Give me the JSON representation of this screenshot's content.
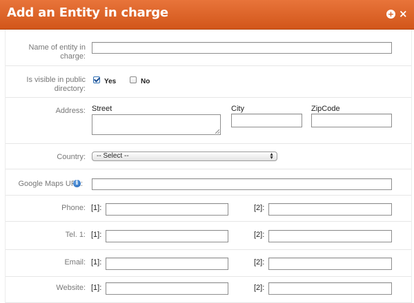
{
  "header": {
    "title": "Add an Entity in charge"
  },
  "fields": {
    "name_label": "Name of entity in charge:",
    "visible_label": "Is visible in public directory:",
    "visible_yes": "Yes",
    "visible_no": "No",
    "visible_selected": "Yes",
    "address_label": "Address:",
    "street_label": "Street",
    "city_label": "City",
    "zip_label": "ZipCode",
    "country_label": "Country:",
    "country_value": "-- Select --",
    "gmaps_label": "Google Maps URL:",
    "phone_label": "Phone:",
    "tel1_label": "Tel. 1:",
    "email_label": "Email:",
    "website_label": "Website:",
    "idx1": "[1]:",
    "idx2": "[2]:"
  },
  "icons": {
    "add": "plus-circle-icon",
    "close": "close-icon",
    "info": "info-icon"
  },
  "colors": {
    "header": "#da5f22",
    "header_text": "#ffffff",
    "checkbox": "#1c4f93"
  }
}
